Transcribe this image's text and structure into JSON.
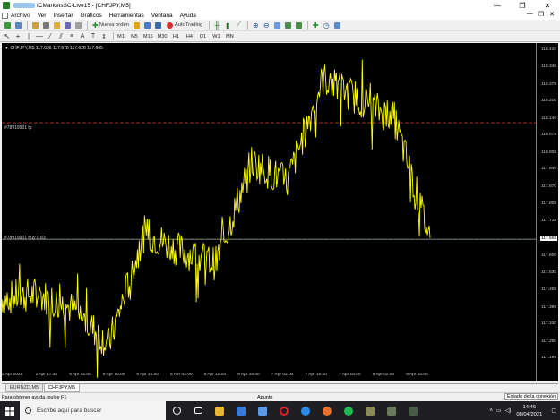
{
  "window": {
    "title": "ICMarketsSC-Live15 - [CHFJPY,M5]",
    "controls": [
      "—",
      "❐",
      "✕"
    ]
  },
  "menu": {
    "items": [
      "Archivo",
      "Ver",
      "Insertar",
      "Gráficos",
      "Herramientas",
      "Ventana",
      "Ayuda"
    ],
    "mdi_controls": [
      "—",
      "❐",
      "✕"
    ]
  },
  "toolbar": {
    "new_order_label": "Nueva orden",
    "autotrading_label": "AutoTrading",
    "timeframes": [
      "M1",
      "M5",
      "M15",
      "M30",
      "H1",
      "H4",
      "D1",
      "W1",
      "MN"
    ]
  },
  "chart": {
    "info_text": "▼ CHFJPY,M5  117.636 117.678 117.628 117.665",
    "order_tp_label": "#78919901 tp",
    "order_buy_label": "#78919901 buy 0.83",
    "current_price_label": "117.665",
    "price_ticks": [
      "118.410",
      "118.345",
      "118.275",
      "118.210",
      "118.140",
      "118.075",
      "118.005",
      "117.940",
      "117.870",
      "117.805",
      "117.735",
      "117.665",
      "117.600",
      "117.530",
      "117.465",
      "117.395",
      "117.330",
      "117.260",
      "117.195"
    ],
    "time_ticks": [
      "2 Apr 2021",
      "2 Apr 17:30",
      "5 Apr 02:00",
      "5 Apr 10:00",
      "5 Apr 18:00",
      "6 Apr 02:00",
      "6 Apr 10:00",
      "6 Apr 18:00",
      "7 Apr 02:00",
      "7 Apr 10:00",
      "7 Apr 18:00",
      "8 Apr 02:00",
      "8 Apr 10:00"
    ]
  },
  "chart_data": {
    "type": "line",
    "title": "CHFJPY,M5",
    "ohlc_header": {
      "open": 117.636,
      "high": 117.678,
      "low": 117.628,
      "close": 117.665
    },
    "x": [
      "2 Apr 2021",
      "2 Apr 17:30",
      "5 Apr 02:00",
      "5 Apr 10:00",
      "5 Apr 18:00",
      "6 Apr 02:00",
      "6 Apr 10:00",
      "6 Apr 18:00",
      "7 Apr 02:00",
      "7 Apr 10:00",
      "7 Apr 18:00",
      "8 Apr 02:00",
      "8 Apr 10:00"
    ],
    "series": [
      {
        "values": [
          117.43,
          117.45,
          117.39,
          117.25,
          117.69,
          117.62,
          117.57,
          117.97,
          117.89,
          118.3,
          118.22,
          118.14,
          117.67
        ]
      }
    ],
    "ylim": [
      117.16,
      118.44
    ],
    "levels": {
      "take_profit": 118.125,
      "buy_entry": 117.665
    },
    "grid": false,
    "colors": {
      "line": "#ffff00",
      "background": "#000000",
      "tp_line": "#c0392b",
      "buy_line": "#1f8a3a"
    }
  },
  "chart_tabs": [
    "EURNZD,M5",
    "CHFJPY,M5"
  ],
  "status": {
    "help_text": "Para obtener ayuda, pulse F1",
    "profile": "Apunto",
    "connection": "Estado de la conexión"
  },
  "taskbar": {
    "search_placeholder": "Escribe aquí para buscar",
    "time": "14:46",
    "date": "08/04/2021"
  }
}
